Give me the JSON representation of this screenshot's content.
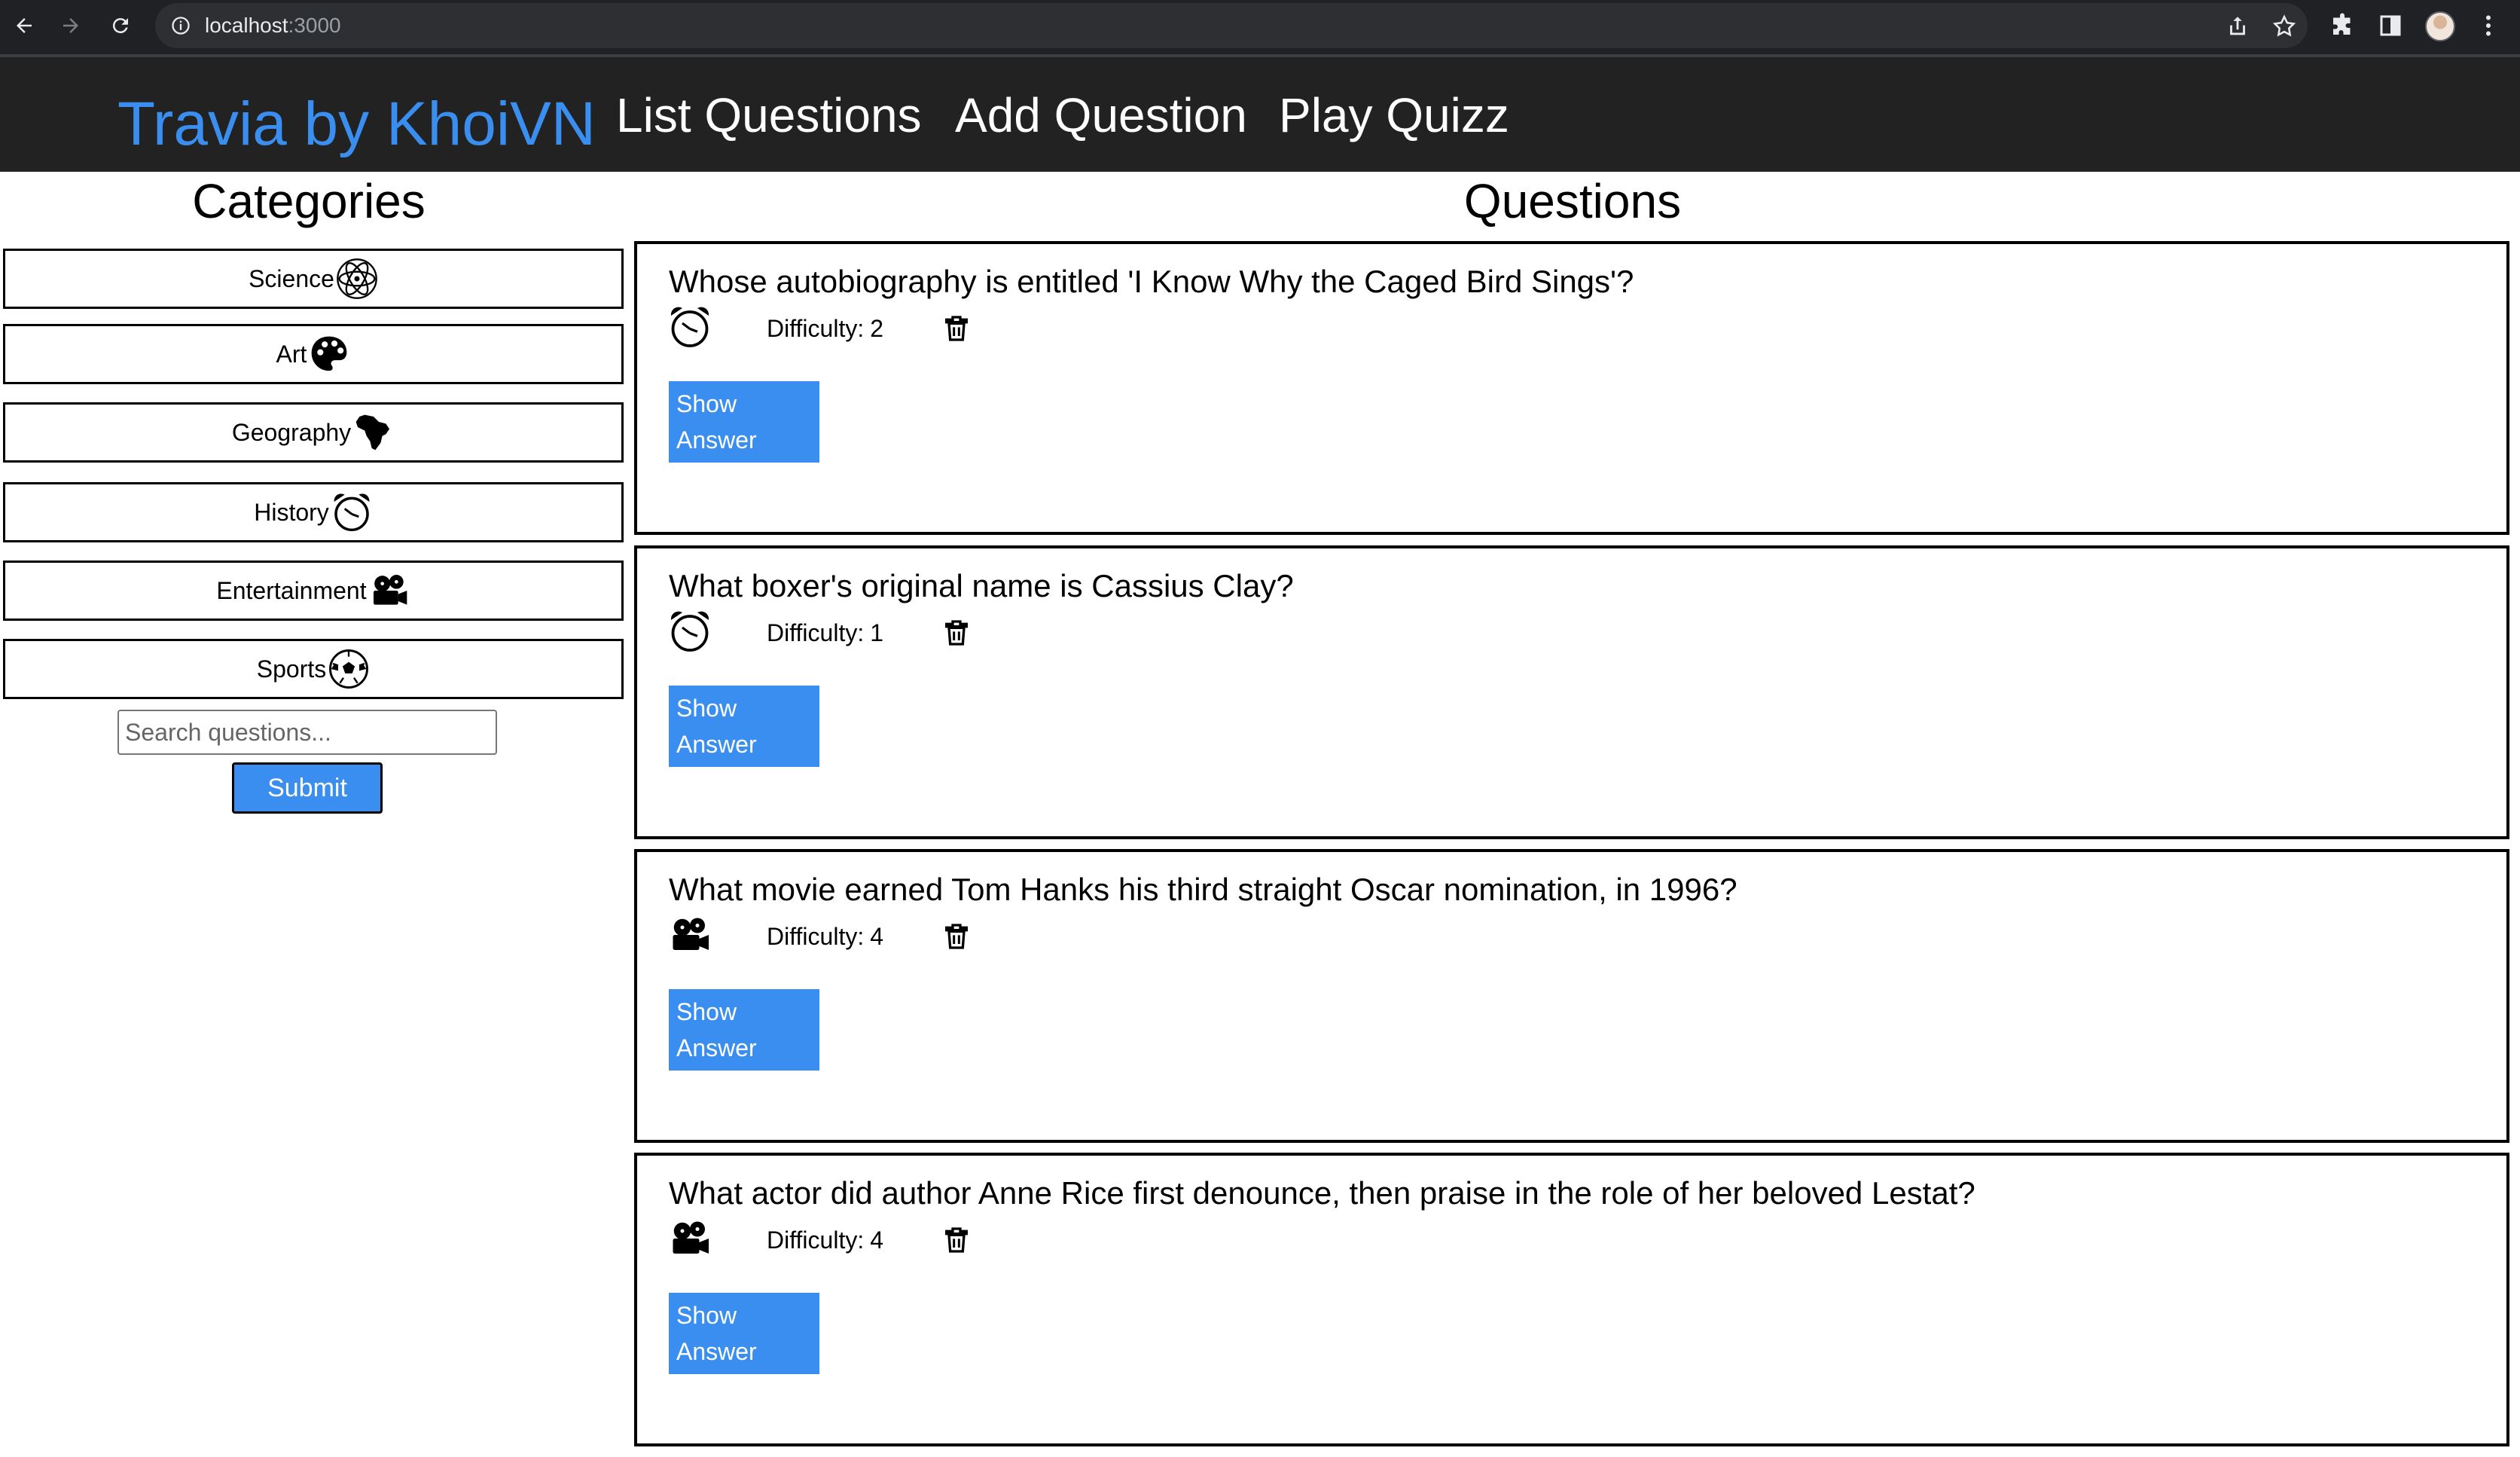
{
  "browser": {
    "url_host": "localhost",
    "url_port": ":3000"
  },
  "header": {
    "brand": "Travia by KhoiVN",
    "nav": [
      {
        "label": "List Questions"
      },
      {
        "label": "Add Question"
      },
      {
        "label": "Play Quizz"
      }
    ]
  },
  "sidebar": {
    "title": "Categories",
    "categories": [
      {
        "label": "Science",
        "icon": "atom-icon"
      },
      {
        "label": "Art",
        "icon": "palette-icon"
      },
      {
        "label": "Geography",
        "icon": "africa-icon"
      },
      {
        "label": "History",
        "icon": "alarm-clock-icon"
      },
      {
        "label": "Entertainment",
        "icon": "film-projector-icon"
      },
      {
        "label": "Sports",
        "icon": "soccer-ball-icon"
      }
    ],
    "search_placeholder": "Search questions...",
    "submit_label": "Submit"
  },
  "questions_section": {
    "title": "Questions",
    "difficulty_label": "Difficulty:",
    "show_answer_line1": "Show",
    "show_answer_line2": "Answer",
    "items": [
      {
        "text": "Whose autobiography is entitled 'I Know Why the Caged Bird Sings'?",
        "difficulty": "2",
        "category_icon": "alarm-clock-icon"
      },
      {
        "text": "What boxer's original name is Cassius Clay?",
        "difficulty": "1",
        "category_icon": "alarm-clock-icon"
      },
      {
        "text": "What movie earned Tom Hanks his third straight Oscar nomination, in 1996?",
        "difficulty": "4",
        "category_icon": "film-projector-icon"
      },
      {
        "text": "What actor did author Anne Rice first denounce, then praise in the role of her beloved Lestat?",
        "difficulty": "4",
        "category_icon": "film-projector-icon"
      }
    ]
  },
  "colors": {
    "accent": "#3a8ef0",
    "header_bg": "#222222",
    "chrome_bg": "#202124"
  }
}
